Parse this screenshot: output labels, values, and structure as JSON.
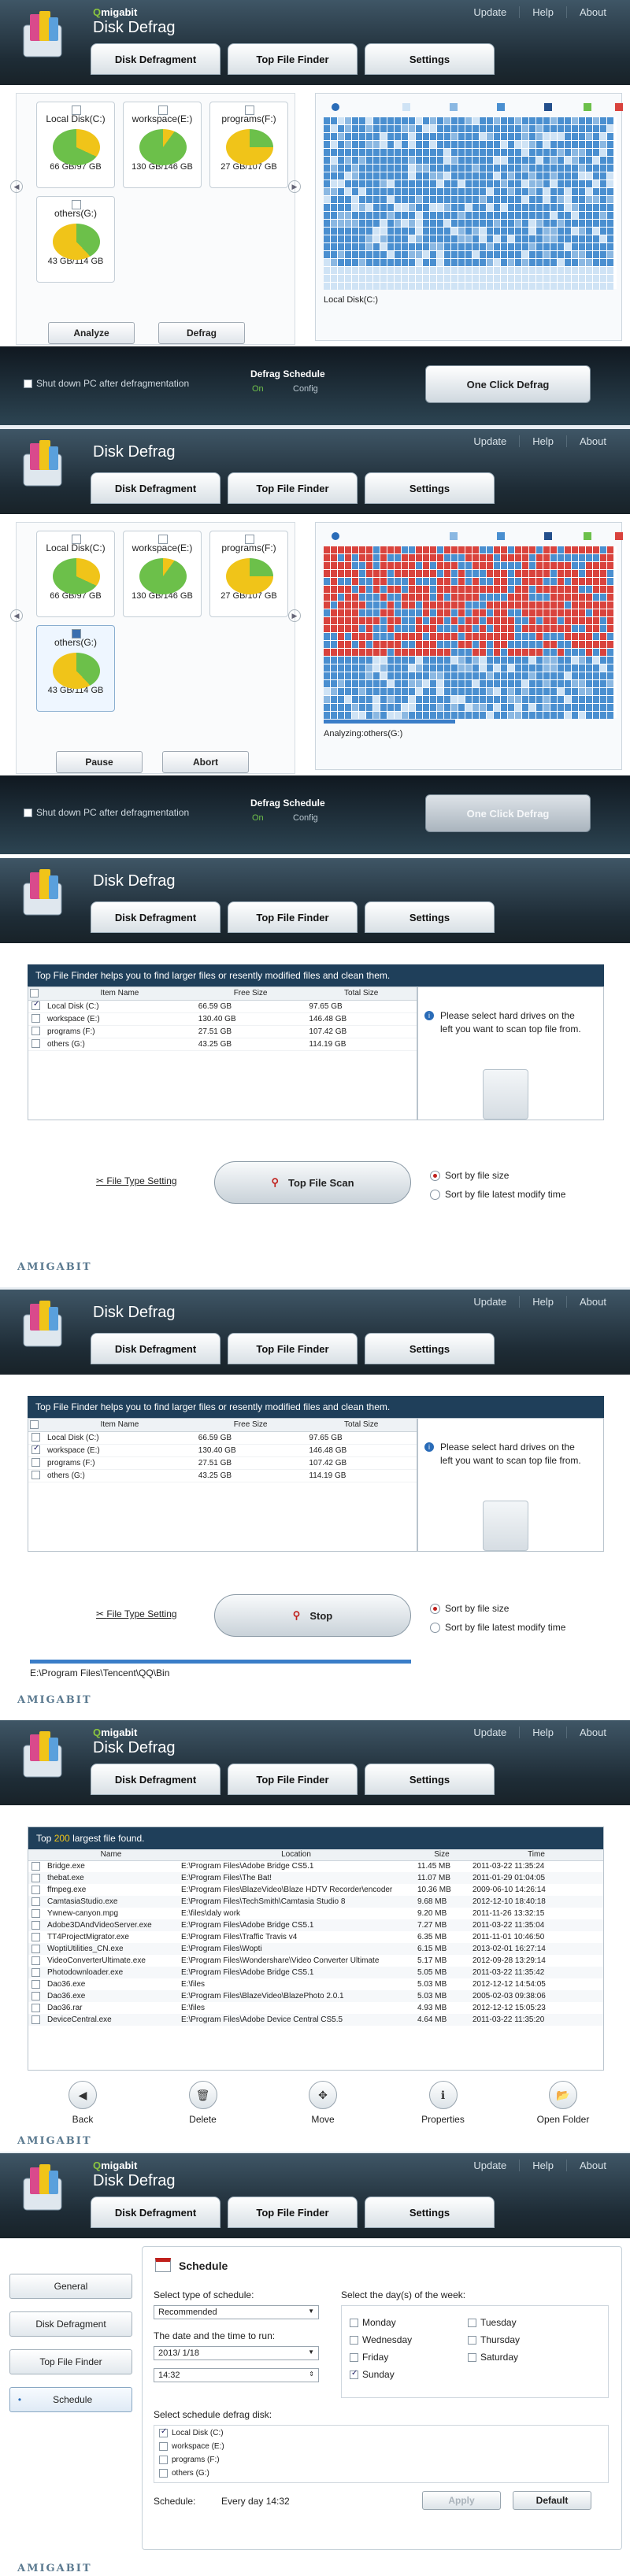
{
  "app": {
    "brand": "migabit",
    "brand_q": "Q",
    "title": "Disk Defrag",
    "menu": [
      "Update",
      "Help",
      "About"
    ],
    "tabs": [
      "Disk Defragment",
      "Top File Finder",
      "Settings"
    ],
    "footer_logo": "AMIGABIT"
  },
  "defrag1": {
    "drives": [
      {
        "name": "Local Disk(C:)",
        "size": "66 GB/97 GB",
        "checked": false
      },
      {
        "name": "workspace(E:)",
        "size": "130 GB/146 GB",
        "checked": false
      },
      {
        "name": "programs(F:)",
        "size": "27 GB/107 GB",
        "checked": false
      },
      {
        "name": "others(G:)",
        "size": "43 GB/114 GB",
        "checked": false
      }
    ],
    "analyze_label": "Analyze",
    "defrag_label": "Defrag",
    "map_label": "Local Disk(C:)",
    "shutdown_label": "Shut down PC after defragmentation",
    "schedule_title": "Defrag Schedule",
    "schedule_on": "On",
    "schedule_config": "Config",
    "one_click_label": "One Click Defrag"
  },
  "defrag2": {
    "drives": [
      {
        "name": "Local Disk(C:)",
        "size": "66 GB/97 GB",
        "checked": false
      },
      {
        "name": "workspace(E:)",
        "size": "130 GB/146 GB",
        "checked": false
      },
      {
        "name": "programs(F:)",
        "size": "27 GB/107 GB",
        "checked": false
      },
      {
        "name": "others(G:)",
        "size": "43 GB/114 GB",
        "checked": true
      }
    ],
    "pause_label": "Pause",
    "abort_label": "Abort",
    "map_label": "Analyzing:others(G:)",
    "progress": 0.45,
    "shutdown_label": "Shut down PC after defragmentation",
    "schedule_title": "Defrag Schedule",
    "schedule_on": "On",
    "schedule_config": "Config",
    "one_click_label": "One Click Defrag"
  },
  "tff1": {
    "header": "Top File Finder helps you to find larger files or resently modified files and clean them.",
    "columns": [
      "Item Name",
      "Free Size",
      "Total Size"
    ],
    "rows": [
      {
        "name": "Local Disk (C:)",
        "free": "66.59 GB",
        "total": "97.65 GB",
        "checked": true
      },
      {
        "name": "workspace (E:)",
        "free": "130.40 GB",
        "total": "146.48 GB",
        "checked": false
      },
      {
        "name": "programs (F:)",
        "free": "27.51 GB",
        "total": "107.42 GB",
        "checked": false
      },
      {
        "name": "others (G:)",
        "free": "43.25 GB",
        "total": "114.19 GB",
        "checked": false
      }
    ],
    "side_msg": "Please select hard drives on the left you want to scan top file from.",
    "file_type_link": "File Type Setting",
    "scan_label": "Top File Scan",
    "sort_size": "Sort by file size",
    "sort_time": "Sort by file latest modify time"
  },
  "tff2": {
    "header": "Top File Finder helps you to find larger files or resently modified files and clean them.",
    "columns": [
      "Item Name",
      "Free Size",
      "Total Size"
    ],
    "rows": [
      {
        "name": "Local Disk (C:)",
        "free": "66.59 GB",
        "total": "97.65 GB",
        "checked": false
      },
      {
        "name": "workspace (E:)",
        "free": "130.40 GB",
        "total": "146.48 GB",
        "checked": true
      },
      {
        "name": "programs (F:)",
        "free": "27.51 GB",
        "total": "107.42 GB",
        "checked": false
      },
      {
        "name": "others (G:)",
        "free": "43.25 GB",
        "total": "114.19 GB",
        "checked": false
      }
    ],
    "side_msg": "Please select hard drives on the left you want to scan top file from.",
    "file_type_link": "File Type Setting",
    "stop_label": "Stop",
    "sort_size": "Sort by file size",
    "sort_time": "Sort by file latest modify time",
    "scan_path": "E:\\Program Files\\Tencent\\QQ\\Bin"
  },
  "results": {
    "title_pre": "Top",
    "title_count": "200",
    "title_post": "largest file found.",
    "columns": [
      "Name",
      "Location",
      "Size",
      "Time"
    ],
    "rows": [
      {
        "name": "Bridge.exe",
        "loc": "E:\\Program Files\\Adobe Bridge CS5.1",
        "size": "11.45 MB",
        "time": "2011-03-22 11:35:24"
      },
      {
        "name": "thebat.exe",
        "loc": "E:\\Program Files\\The Bat!",
        "size": "11.07 MB",
        "time": "2011-01-29 01:04:05"
      },
      {
        "name": "ffmpeg.exe",
        "loc": "E:\\Program Files\\BlazeVideo\\Blaze HDTV Recorder\\encoder",
        "size": "10.36 MB",
        "time": "2009-06-10 14:26:14"
      },
      {
        "name": "CamtasiaStudio.exe",
        "loc": "E:\\Program Files\\TechSmith\\Camtasia Studio 8",
        "size": "9.68 MB",
        "time": "2012-12-10 18:40:18"
      },
      {
        "name": "Ywnew-canyon.mpg",
        "loc": "E:\\files\\daly work",
        "size": "9.20 MB",
        "time": "2011-11-26 13:32:15"
      },
      {
        "name": "Adobe3DAndVideoServer.exe",
        "loc": "E:\\Program Files\\Adobe Bridge CS5.1",
        "size": "7.27 MB",
        "time": "2011-03-22 11:35:04"
      },
      {
        "name": "TT4ProjectMigrator.exe",
        "loc": "E:\\Program Files\\Traffic Travis v4",
        "size": "6.35 MB",
        "time": "2011-11-01 10:46:50"
      },
      {
        "name": "WoptiUtilities_CN.exe",
        "loc": "E:\\Program Files\\Wopti",
        "size": "6.15 MB",
        "time": "2013-02-01 16:27:14"
      },
      {
        "name": "VideoConverterUltimate.exe",
        "loc": "E:\\Program Files\\Wondershare\\Video Converter Ultimate",
        "size": "5.17 MB",
        "time": "2012-09-28 13:29:14"
      },
      {
        "name": "Photodownloader.exe",
        "loc": "E:\\Program Files\\Adobe Bridge CS5.1",
        "size": "5.05 MB",
        "time": "2011-03-22 11:35:42"
      },
      {
        "name": "Dao36.exe",
        "loc": "E:\\files",
        "size": "5.03 MB",
        "time": "2012-12-12 14:54:05"
      },
      {
        "name": "Dao36.exe",
        "loc": "E:\\Program Files\\BlazeVideo\\BlazePhoto 2.0.1",
        "size": "5.03 MB",
        "time": "2005-02-03 09:38:06"
      },
      {
        "name": "Dao36.rar",
        "loc": "E:\\files",
        "size": "4.93 MB",
        "time": "2012-12-12 15:05:23"
      },
      {
        "name": "DeviceCentral.exe",
        "loc": "E:\\Program Files\\Adobe Device Central CS5.5",
        "size": "4.64 MB",
        "time": "2011-03-22 11:35:20"
      }
    ],
    "actions": [
      {
        "label": "Back",
        "icon": "back-arrow-icon",
        "glyph": "◀"
      },
      {
        "label": "Delete",
        "icon": "trash-icon",
        "glyph": "🗑"
      },
      {
        "label": "Move",
        "icon": "move-icon",
        "glyph": "✥"
      },
      {
        "label": "Properties",
        "icon": "info-icon",
        "glyph": "ℹ"
      },
      {
        "label": "Open Folder",
        "icon": "folder-icon",
        "glyph": "📂"
      }
    ]
  },
  "settings": {
    "nav": [
      "General",
      "Disk Defragment",
      "Top File Finder",
      "Schedule"
    ],
    "panel_title": "Schedule",
    "type_label": "Select type of schedule:",
    "type_value": "Recommended",
    "datetime_label": "The date and the time to run:",
    "date_value": "2013/ 1/18",
    "time_value": "14:32",
    "days_label": "Select the day(s) of the week:",
    "days": [
      {
        "label": "Monday",
        "checked": false
      },
      {
        "label": "Tuesday",
        "checked": false
      },
      {
        "label": "Wednesday",
        "checked": false
      },
      {
        "label": "Thursday",
        "checked": false
      },
      {
        "label": "Friday",
        "checked": false
      },
      {
        "label": "Saturday",
        "checked": false
      },
      {
        "label": "Sunday",
        "checked": true
      }
    ],
    "disk_label": "Select schedule defrag disk:",
    "disks": [
      {
        "label": "Local Disk (C:)",
        "checked": true
      },
      {
        "label": "workspace (E:)",
        "checked": false
      },
      {
        "label": "programs (F:)",
        "checked": false
      },
      {
        "label": "others (G:)",
        "checked": false
      }
    ],
    "schedule_label": "Schedule:",
    "schedule_value": "Every day 14:32",
    "apply_label": "Apply",
    "default_label": "Default"
  },
  "colors": {
    "used_green": "#6cc04a",
    "free_yellow": "#f0c419",
    "block_blue": "#4a8fd0",
    "block_red": "#d9433d",
    "header_dark": "#1f3f5a"
  }
}
